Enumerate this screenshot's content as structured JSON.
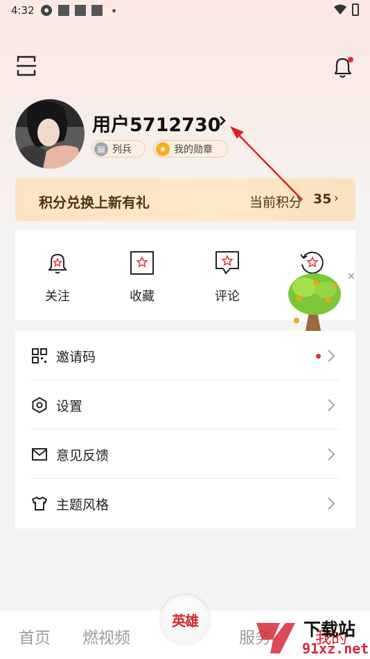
{
  "status_bar": {
    "time": "4:32"
  },
  "profile": {
    "username": "用户5712730",
    "badges": [
      "列兵",
      "我的勋章"
    ]
  },
  "points_banner": {
    "title": "积分兑换上新有礼",
    "current_label": "当前积分",
    "current_value": "35"
  },
  "quick_actions": [
    {
      "label": "关注",
      "icon": "bell-outline-icon"
    },
    {
      "label": "收藏",
      "icon": "star-box-icon"
    },
    {
      "label": "评论",
      "icon": "comment-star-icon"
    },
    {
      "label": "",
      "icon": "history-star-icon"
    }
  ],
  "menu": [
    {
      "label": "邀请码",
      "icon": "qr-grid-icon",
      "has_dot": true
    },
    {
      "label": "设置",
      "icon": "hexagon-settings-icon"
    },
    {
      "label": "意见反馈",
      "icon": "mail-icon"
    },
    {
      "label": "主题风格",
      "icon": "tshirt-icon"
    }
  ],
  "tabbar": {
    "tabs": [
      "首页",
      "燃视频",
      "服务",
      "我的"
    ],
    "center_label": "英雄"
  },
  "watermark": {
    "main": "下载站",
    "sub": "91xz.net"
  },
  "colors": {
    "accent_red": "#e0303a",
    "banner": "#fce3c4",
    "annotation_arrow": "#e02020"
  }
}
